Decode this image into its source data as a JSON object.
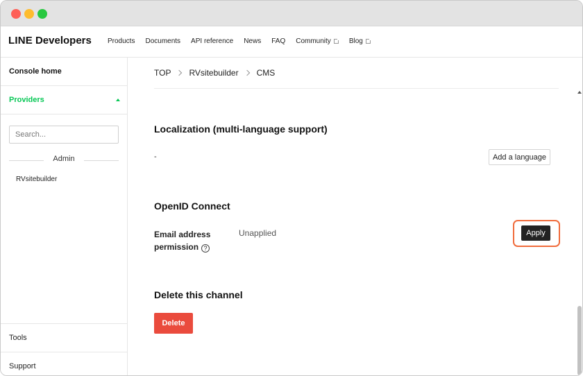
{
  "header": {
    "logo_line": "LINE",
    "logo_developers": "Developers",
    "nav": [
      {
        "label": "Products",
        "external": false
      },
      {
        "label": "Documents",
        "external": false
      },
      {
        "label": "API reference",
        "external": false
      },
      {
        "label": "News",
        "external": false
      },
      {
        "label": "FAQ",
        "external": false
      },
      {
        "label": "Community",
        "external": true
      },
      {
        "label": "Blog",
        "external": true
      }
    ]
  },
  "sidebar": {
    "console_home": "Console home",
    "providers": "Providers",
    "search_placeholder": "Search...",
    "section": "Admin",
    "items": [
      "RVsitebuilder"
    ],
    "tools": "Tools",
    "support": "Support"
  },
  "breadcrumb": [
    "TOP",
    "RVsitebuilder",
    "CMS"
  ],
  "localization": {
    "title": "Localization (multi-language support)",
    "value": "-",
    "add_button": "Add a language"
  },
  "openid": {
    "title": "OpenID Connect",
    "email_label_1": "Email address",
    "email_label_2": "permission",
    "help_icon": "?",
    "status": "Unapplied",
    "apply_button": "Apply"
  },
  "delete_section": {
    "title": "Delete this channel",
    "button": "Delete"
  },
  "colors": {
    "brand_green": "#06c755",
    "delete_red": "#ea4b3d",
    "highlight": "#f06b3b"
  }
}
